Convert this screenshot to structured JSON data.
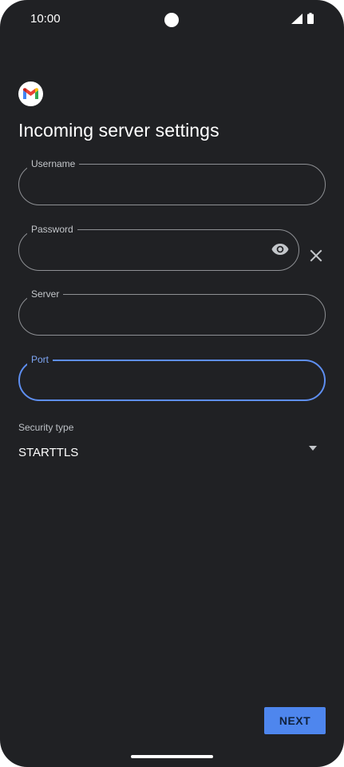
{
  "status_bar": {
    "time": "10:00"
  },
  "page": {
    "title": "Incoming server settings"
  },
  "fields": {
    "username": {
      "label": "Username",
      "value": ""
    },
    "password": {
      "label": "Password",
      "value": ""
    },
    "server": {
      "label": "Server",
      "value": ""
    },
    "port": {
      "label": "Port",
      "value": ""
    }
  },
  "security": {
    "label": "Security type",
    "value": "STARTTLS"
  },
  "actions": {
    "next_label": "NEXT"
  },
  "icons": {
    "logo": "gmail-logo-icon",
    "eye": "eye-icon",
    "clear": "close-icon",
    "dropdown": "dropdown-arrow-icon",
    "signal": "signal-icon",
    "battery": "battery-icon"
  },
  "colors": {
    "background": "#202124",
    "accent": "#4e86ee",
    "focused_border": "#5e8ff1",
    "outline": "#8e9094"
  }
}
